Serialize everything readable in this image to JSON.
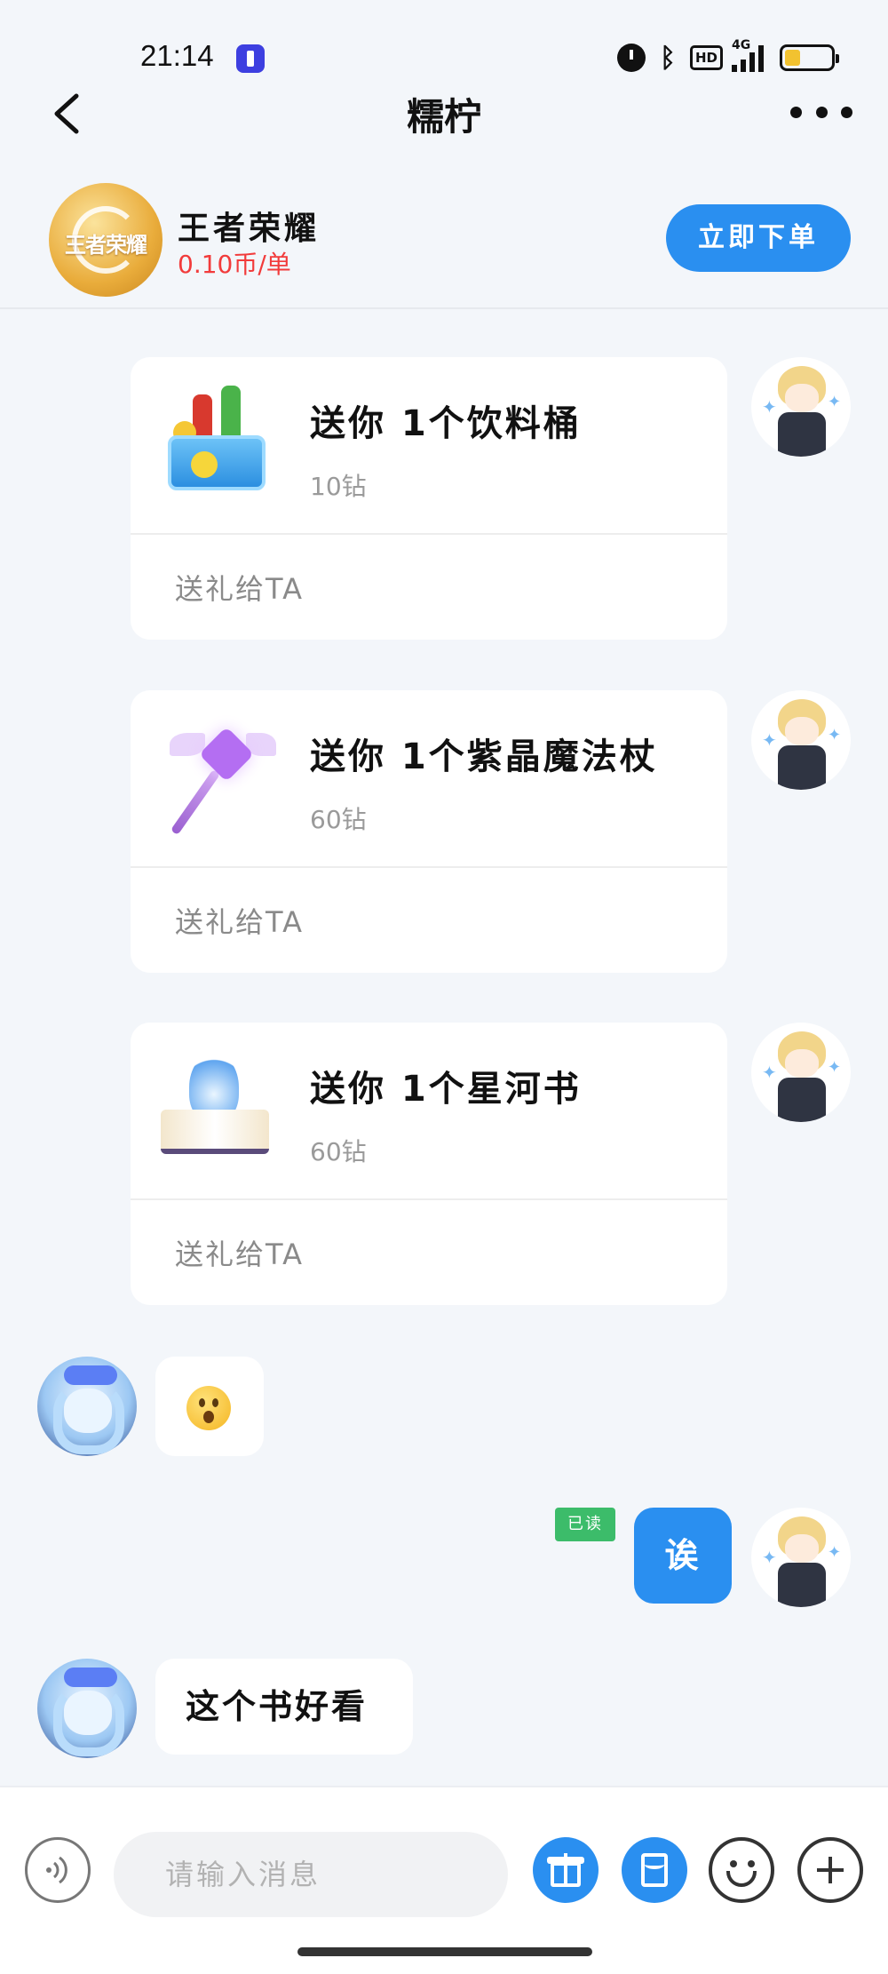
{
  "status_bar": {
    "time": "21:14",
    "icons": [
      "flashlight-icon",
      "alarm-icon",
      "bluetooth-icon",
      "hd-icon",
      "signal-4g-icon",
      "battery-icon"
    ],
    "network": "4G",
    "hd": "HD",
    "battery_level": 0.25
  },
  "nav": {
    "title": "糯柠",
    "back_icon": "chevron-left-icon",
    "more_icon": "more-horizontal-icon"
  },
  "game": {
    "name": "王者荣耀",
    "logo_text": "王者荣耀",
    "price": "0.10币/单",
    "order_button": "立即下单",
    "price_color": "#f23b3b",
    "accent_color": "#2a8ff0"
  },
  "messages": [
    {
      "type": "gift",
      "side": "right",
      "title": "送你 1个饮料桶",
      "cost": "10钻",
      "action": "送礼给TA",
      "icon": "drink-cooler-icon"
    },
    {
      "type": "gift",
      "side": "right",
      "title": "送你 1个紫晶魔法杖",
      "cost": "60钻",
      "action": "送礼给TA",
      "icon": "magic-wand-icon"
    },
    {
      "type": "gift",
      "side": "right",
      "title": "送你 1个星河书",
      "cost": "60钻",
      "action": "送礼给TA",
      "icon": "galaxy-book-icon"
    },
    {
      "type": "emoji",
      "side": "left",
      "icon": "surprised-face-emoji"
    },
    {
      "type": "text",
      "side": "right",
      "text": "诶",
      "read_badge": "已读"
    },
    {
      "type": "text",
      "side": "left",
      "text": "这个书好看"
    }
  ],
  "input_bar": {
    "placeholder": "请输入消息",
    "voice_icon": "voice-icon",
    "gift_icon": "gift-icon",
    "redpack_icon": "red-packet-icon",
    "emoji_icon": "emoji-icon",
    "plus_icon": "plus-icon"
  }
}
